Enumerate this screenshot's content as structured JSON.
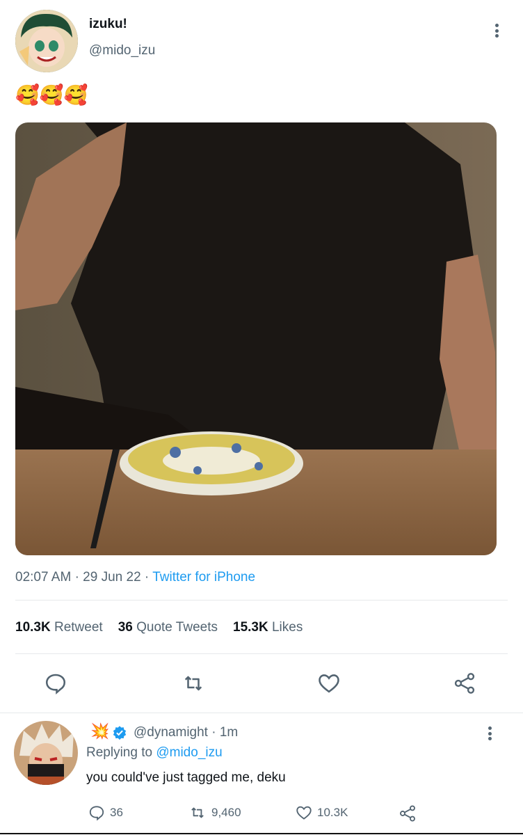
{
  "tweet": {
    "author_name": "izuku!",
    "author_handle": "@mido_izu",
    "text": "🥰🥰🥰",
    "time": "02:07 AM",
    "date": "29 Jun 22",
    "source": "Twitter for iPhone",
    "stats": {
      "retweets_count": "10.3K",
      "retweets_label": "Retweet",
      "quotes_count": "36",
      "quotes_label": "Quote Tweets",
      "likes_count": "15.3K",
      "likes_label": "Likes"
    }
  },
  "reply": {
    "name_emoji": "💥",
    "handle": "@dynamight",
    "time": "1m",
    "replying_to_label": "Replying to",
    "replying_to_handle": "@mido_izu",
    "text": "you could've just tagged me, deku",
    "counts": {
      "replies": "36",
      "retweets": "9,460",
      "likes": "10.3K"
    }
  },
  "colors": {
    "accent": "#1d9bf0",
    "muted": "#536471",
    "verified": "#1d9bf0"
  },
  "icons": [
    "reply-icon",
    "retweet-icon",
    "like-icon",
    "share-icon",
    "kebab-icon",
    "verified-badge-icon"
  ]
}
